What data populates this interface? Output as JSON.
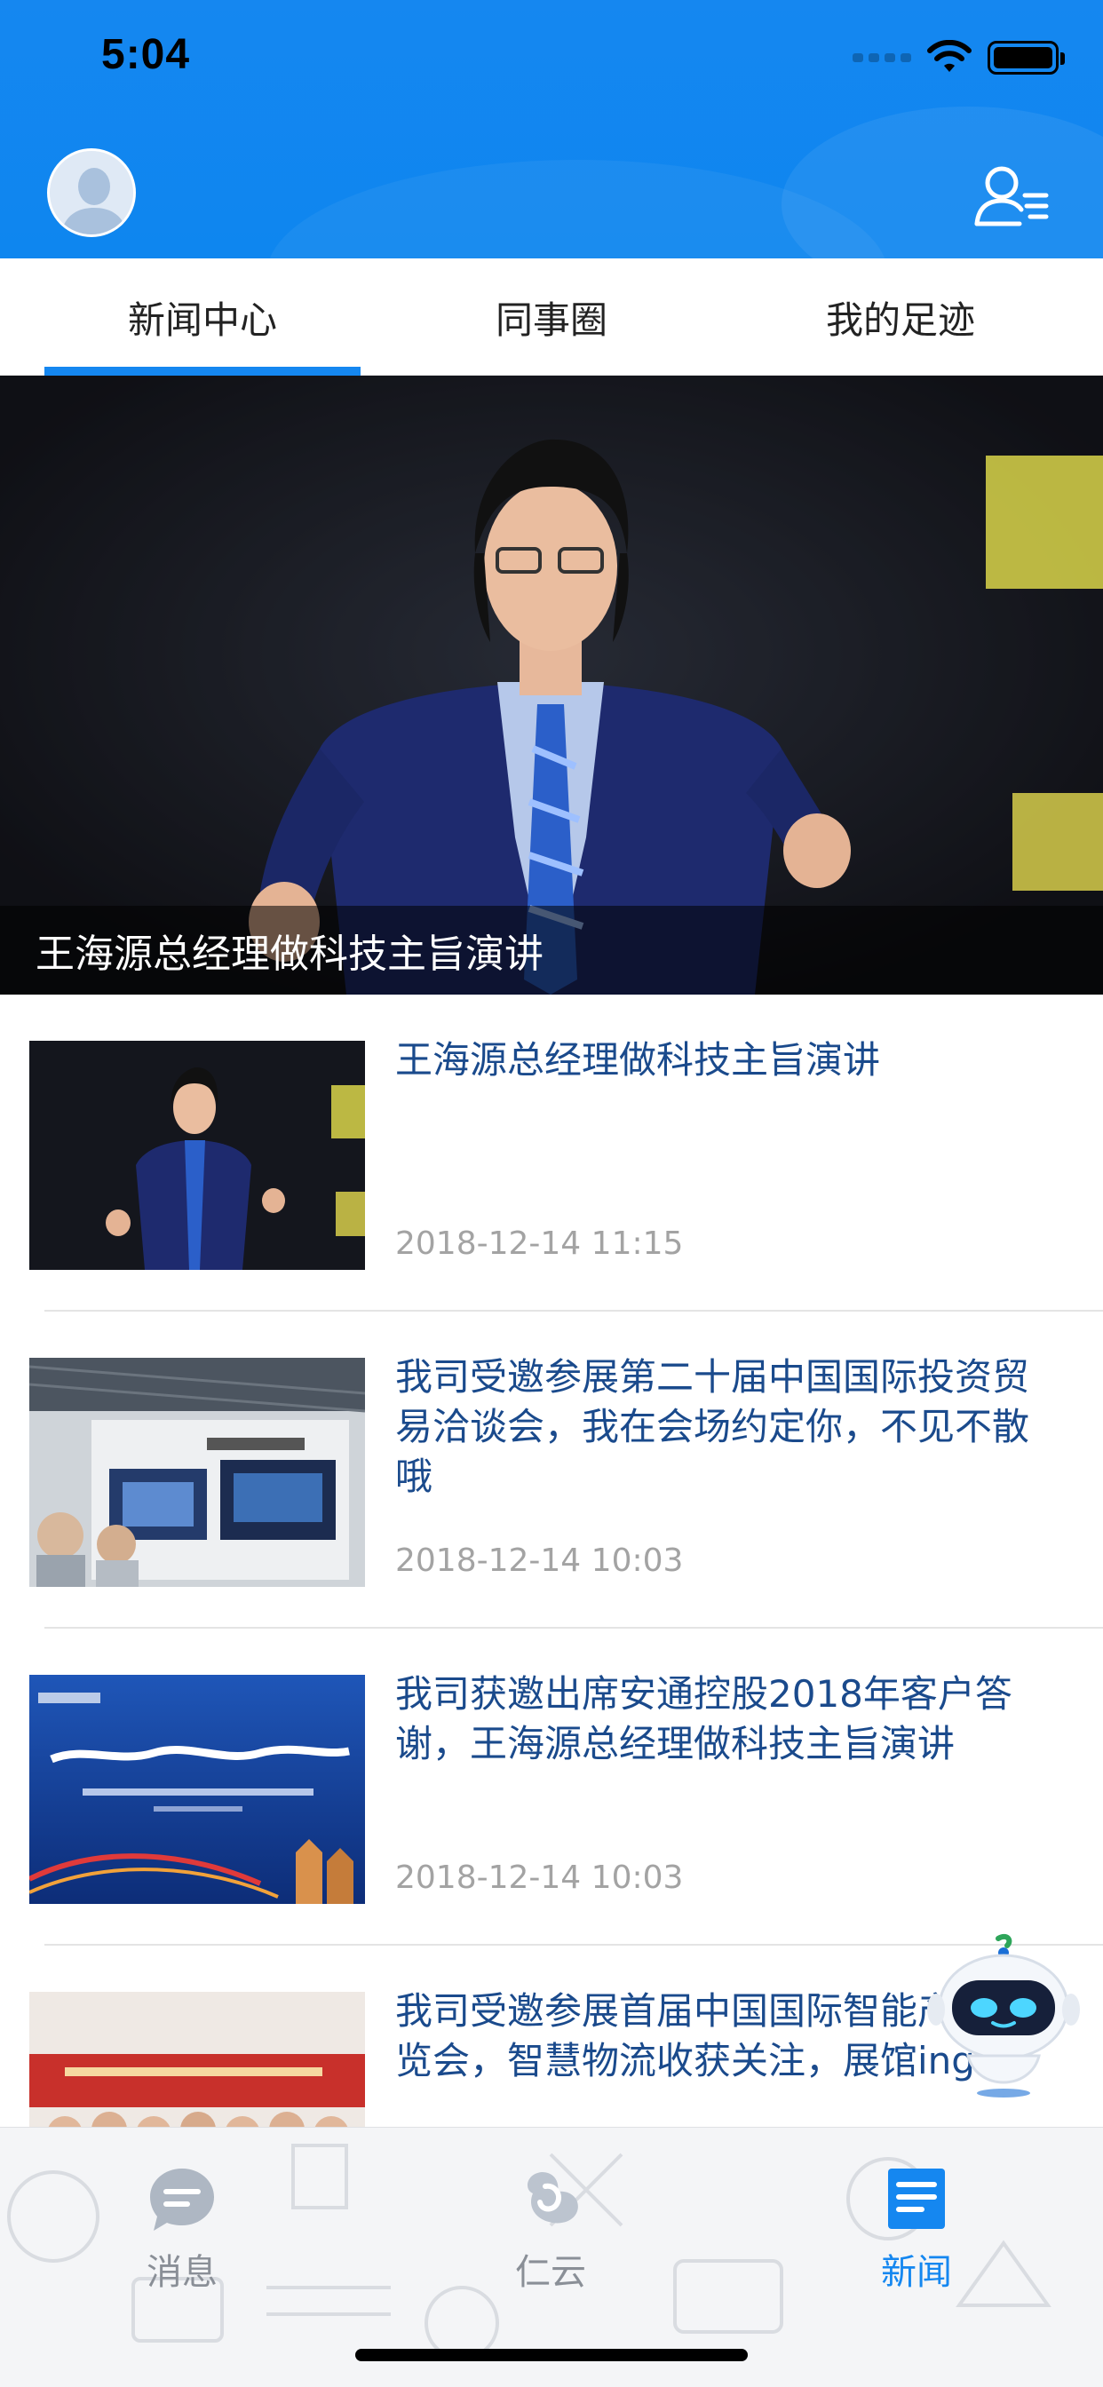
{
  "status_bar": {
    "time": "5:04"
  },
  "tabs": [
    {
      "label": "新闻中心",
      "active": true
    },
    {
      "label": "同事圈",
      "active": false
    },
    {
      "label": "我的足迹",
      "active": false
    }
  ],
  "banner": {
    "caption": "王海源总经理做科技主旨演讲"
  },
  "news": [
    {
      "title": "王海源总经理做科技主旨演讲",
      "date": "2018-12-14 11:15"
    },
    {
      "title": "我司受邀参展第二十届中国国际投资贸易洽谈会，我在会场约定你，不见不散哦",
      "date": "2018-12-14 10:03"
    },
    {
      "title": "我司获邀出席安通控股2018年客户答谢，王海源总经理做科技主旨演讲",
      "date": "2018-12-14 10:03"
    },
    {
      "title": "我司受邀参展首届中国国际智能产业博览会，智慧物流收获关注，展馆ing",
      "date": ""
    }
  ],
  "bottom_nav": [
    {
      "label": "消息",
      "icon": "chat-bubble-icon",
      "active": false
    },
    {
      "label": "仁云",
      "icon": "cloud-logo-icon",
      "active": false
    },
    {
      "label": "新闻",
      "icon": "news-doc-icon",
      "active": true
    }
  ],
  "colors": {
    "primary": "#1587f0",
    "title": "#1a4a8c",
    "date": "#a3a3a3"
  }
}
